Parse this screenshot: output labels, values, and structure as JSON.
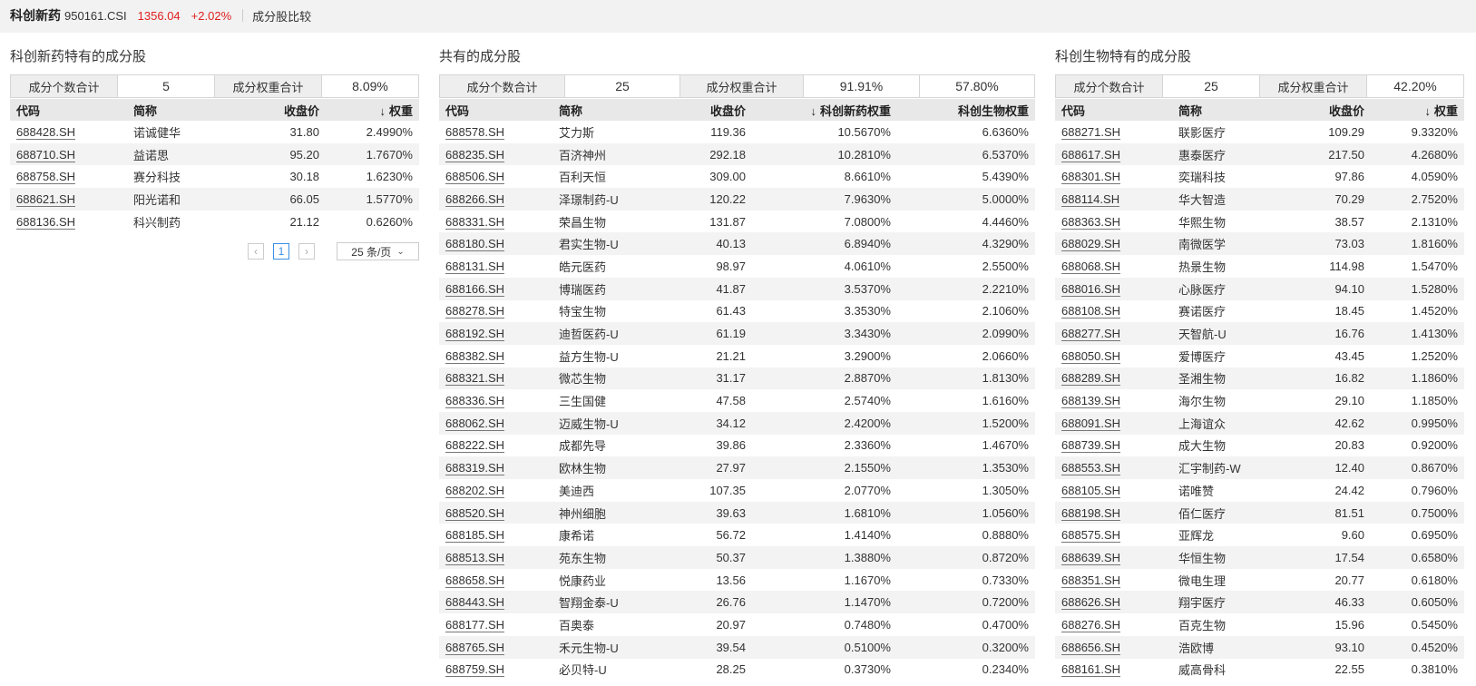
{
  "header": {
    "index_name": "科创新药",
    "index_code": "950161.CSI",
    "price": "1356.04",
    "change": "+2.02%",
    "tab_label": "成分股比较",
    "colors": {
      "up": "#e02020",
      "accent": "#3a8ee6"
    }
  },
  "left": {
    "title": "科创新药特有的成分股",
    "summary": {
      "count_label": "成分个数合计",
      "count_value": "5",
      "weight_label": "成分权重合计",
      "weight_value": "8.09%"
    },
    "columns": [
      "代码",
      "简称",
      "收盘价",
      "权重"
    ],
    "sort_indicator": "↓",
    "rows": [
      [
        "688428.SH",
        "诺诚健华",
        "31.80",
        "2.4990%"
      ],
      [
        "688710.SH",
        "益诺思",
        "95.20",
        "1.7670%"
      ],
      [
        "688758.SH",
        "赛分科技",
        "30.18",
        "1.6230%"
      ],
      [
        "688621.SH",
        "阳光诺和",
        "66.05",
        "1.5770%"
      ],
      [
        "688136.SH",
        "科兴制药",
        "21.12",
        "0.6260%"
      ]
    ],
    "pager": {
      "prev_icon": "‹",
      "page": "1",
      "next_icon": "›",
      "page_size": "25 条/页",
      "chevron_icon": "chevron-down-icon"
    }
  },
  "mid": {
    "title": "共有的成分股",
    "summary": {
      "count_label": "成分个数合计",
      "count_value": "25",
      "weight_label": "成分权重合计",
      "weight_value_a": "91.91%",
      "weight_value_b": "57.80%"
    },
    "columns": [
      "代码",
      "简称",
      "收盘价",
      "科创新药权重",
      "科创生物权重"
    ],
    "sort_indicator": "↓",
    "rows": [
      [
        "688578.SH",
        "艾力斯",
        "119.36",
        "10.5670%",
        "6.6360%"
      ],
      [
        "688235.SH",
        "百济神州",
        "292.18",
        "10.2810%",
        "6.5370%"
      ],
      [
        "688506.SH",
        "百利天恒",
        "309.00",
        "8.6610%",
        "5.4390%"
      ],
      [
        "688266.SH",
        "泽璟制药-U",
        "120.22",
        "7.9630%",
        "5.0000%"
      ],
      [
        "688331.SH",
        "荣昌生物",
        "131.87",
        "7.0800%",
        "4.4460%"
      ],
      [
        "688180.SH",
        "君实生物-U",
        "40.13",
        "6.8940%",
        "4.3290%"
      ],
      [
        "688131.SH",
        "皓元医药",
        "98.97",
        "4.0610%",
        "2.5500%"
      ],
      [
        "688166.SH",
        "博瑞医药",
        "41.87",
        "3.5370%",
        "2.2210%"
      ],
      [
        "688278.SH",
        "特宝生物",
        "61.43",
        "3.3530%",
        "2.1060%"
      ],
      [
        "688192.SH",
        "迪哲医药-U",
        "61.19",
        "3.3430%",
        "2.0990%"
      ],
      [
        "688382.SH",
        "益方生物-U",
        "21.21",
        "3.2900%",
        "2.0660%"
      ],
      [
        "688321.SH",
        "微芯生物",
        "31.17",
        "2.8870%",
        "1.8130%"
      ],
      [
        "688336.SH",
        "三生国健",
        "47.58",
        "2.5740%",
        "1.6160%"
      ],
      [
        "688062.SH",
        "迈威生物-U",
        "34.12",
        "2.4200%",
        "1.5200%"
      ],
      [
        "688222.SH",
        "成都先导",
        "39.86",
        "2.3360%",
        "1.4670%"
      ],
      [
        "688319.SH",
        "欧林生物",
        "27.97",
        "2.1550%",
        "1.3530%"
      ],
      [
        "688202.SH",
        "美迪西",
        "107.35",
        "2.0770%",
        "1.3050%"
      ],
      [
        "688520.SH",
        "神州细胞",
        "39.63",
        "1.6810%",
        "1.0560%"
      ],
      [
        "688185.SH",
        "康希诺",
        "56.72",
        "1.4140%",
        "0.8880%"
      ],
      [
        "688513.SH",
        "苑东生物",
        "50.37",
        "1.3880%",
        "0.8720%"
      ],
      [
        "688658.SH",
        "悦康药业",
        "13.56",
        "1.1670%",
        "0.7330%"
      ],
      [
        "688443.SH",
        "智翔金泰-U",
        "26.76",
        "1.1470%",
        "0.7200%"
      ],
      [
        "688177.SH",
        "百奥泰",
        "20.97",
        "0.7480%",
        "0.4700%"
      ],
      [
        "688765.SH",
        "禾元生物-U",
        "39.54",
        "0.5100%",
        "0.3200%"
      ],
      [
        "688759.SH",
        "必贝特-U",
        "28.25",
        "0.3730%",
        "0.2340%"
      ]
    ]
  },
  "right": {
    "title": "科创生物特有的成分股",
    "summary": {
      "count_label": "成分个数合计",
      "count_value": "25",
      "weight_label": "成分权重合计",
      "weight_value": "42.20%"
    },
    "columns": [
      "代码",
      "简称",
      "收盘价",
      "权重"
    ],
    "sort_indicator": "↓",
    "rows": [
      [
        "688271.SH",
        "联影医疗",
        "109.29",
        "9.3320%"
      ],
      [
        "688617.SH",
        "惠泰医疗",
        "217.50",
        "4.2680%"
      ],
      [
        "688301.SH",
        "奕瑞科技",
        "97.86",
        "4.0590%"
      ],
      [
        "688114.SH",
        "华大智造",
        "70.29",
        "2.7520%"
      ],
      [
        "688363.SH",
        "华熙生物",
        "38.57",
        "2.1310%"
      ],
      [
        "688029.SH",
        "南微医学",
        "73.03",
        "1.8160%"
      ],
      [
        "688068.SH",
        "热景生物",
        "114.98",
        "1.5470%"
      ],
      [
        "688016.SH",
        "心脉医疗",
        "94.10",
        "1.5280%"
      ],
      [
        "688108.SH",
        "赛诺医疗",
        "18.45",
        "1.4520%"
      ],
      [
        "688277.SH",
        "天智航-U",
        "16.76",
        "1.4130%"
      ],
      [
        "688050.SH",
        "爱博医疗",
        "43.45",
        "1.2520%"
      ],
      [
        "688289.SH",
        "圣湘生物",
        "16.82",
        "1.1860%"
      ],
      [
        "688139.SH",
        "海尔生物",
        "29.10",
        "1.1850%"
      ],
      [
        "688091.SH",
        "上海谊众",
        "42.62",
        "0.9950%"
      ],
      [
        "688739.SH",
        "成大生物",
        "20.83",
        "0.9200%"
      ],
      [
        "688553.SH",
        "汇宇制药-W",
        "12.40",
        "0.8670%"
      ],
      [
        "688105.SH",
        "诺唯赞",
        "24.42",
        "0.7960%"
      ],
      [
        "688198.SH",
        "佰仁医疗",
        "81.51",
        "0.7500%"
      ],
      [
        "688575.SH",
        "亚辉龙",
        "9.60",
        "0.6950%"
      ],
      [
        "688639.SH",
        "华恒生物",
        "17.54",
        "0.6580%"
      ],
      [
        "688351.SH",
        "微电生理",
        "20.77",
        "0.6180%"
      ],
      [
        "688626.SH",
        "翔宇医疗",
        "46.33",
        "0.6050%"
      ],
      [
        "688276.SH",
        "百克生物",
        "15.96",
        "0.5450%"
      ],
      [
        "688656.SH",
        "浩欧博",
        "93.10",
        "0.4520%"
      ],
      [
        "688161.SH",
        "威高骨科",
        "22.55",
        "0.3810%"
      ]
    ]
  }
}
